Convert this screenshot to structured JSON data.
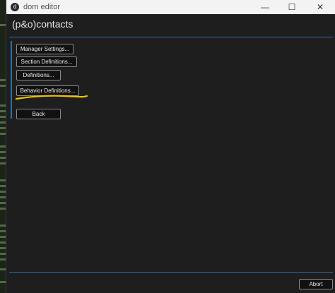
{
  "window": {
    "app_icon_glyph": "d",
    "title": "dom editor",
    "controls": {
      "minimize": "—",
      "maximize": "☐",
      "close": "✕"
    }
  },
  "heading": "(p&o)contacts",
  "menu": {
    "items": [
      {
        "label": "Manager Settings..."
      },
      {
        "label": "Section Definitions..."
      },
      {
        "label": "Definitions..."
      },
      {
        "label": "Behavior Definitions..."
      }
    ],
    "back_label": "Back"
  },
  "footer": {
    "abort_label": "Abort"
  },
  "colors": {
    "accent": "#2f6fa8",
    "highlight": "#f2c200",
    "background": "#1e1e1e",
    "button_bg": "#111111"
  },
  "icons": {
    "app": "dom-editor-app-icon",
    "minimize": "minimize-icon",
    "maximize": "maximize-icon",
    "close": "close-icon"
  }
}
